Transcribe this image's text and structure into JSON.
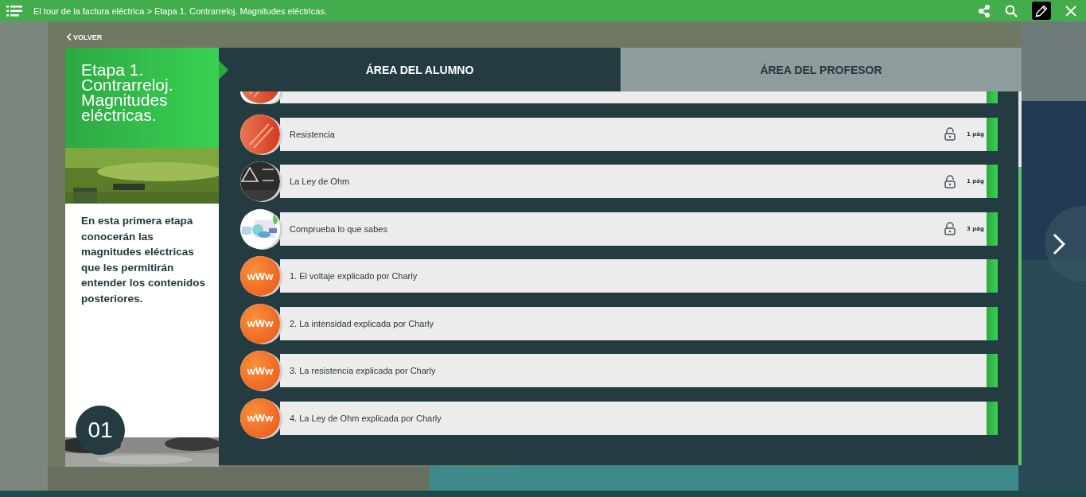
{
  "top_bar": {
    "breadcrumb": "El tour de la factura eléctrica > Etapa 1. Contrarreloj. Magnitudes eléctricas.",
    "edit_active": true
  },
  "back_link": "VOLVER",
  "stage": {
    "title": "Etapa 1. Contrarreloj. Magnitudes eléctricas.",
    "description": "En esta primera etapa conocerán las magnitudes eléctricas que les permitirán entender los contenidos posteriores.",
    "number": "01"
  },
  "tabs": [
    {
      "label": "ÁREA DEL ALUMNO",
      "selected": true
    },
    {
      "label": "ÁREA DEL PROFESOR",
      "selected": false
    }
  ],
  "items": [
    {
      "kind": "disc"
    },
    {
      "kind": "disc",
      "title": "Resistencia",
      "locked": false,
      "pages": "1 pág"
    },
    {
      "kind": "picture",
      "title": "La Ley de Ohm",
      "locked": false,
      "pages": "1 pág"
    },
    {
      "kind": "picture",
      "title": "Comprueba lo que sabes",
      "locked": false,
      "pages": "3 pág"
    },
    {
      "kind": "web",
      "badge": "wWw",
      "title": "1. El voltaje explicado por Charly"
    },
    {
      "kind": "web",
      "badge": "wWw",
      "title": "2. La intensidad explicada por Charly"
    },
    {
      "kind": "web",
      "badge": "wWw",
      "title": "3. La resistencia explicada por Charly"
    },
    {
      "kind": "web",
      "badge": "wWw",
      "title": "4. La Ley de Ohm explicada por Charly"
    }
  ]
}
